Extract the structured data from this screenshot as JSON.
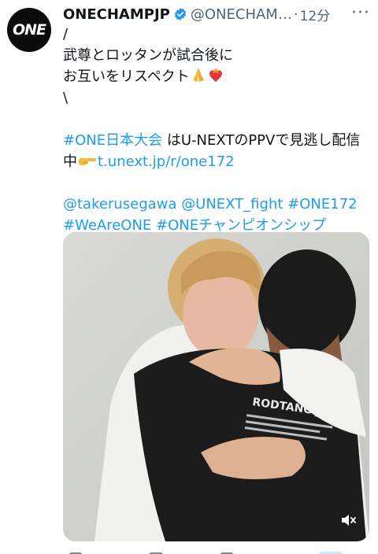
{
  "account": {
    "name": "ONECHAMPJP",
    "handle": "@ONECHAM…",
    "separator": "·",
    "time": "12分",
    "avatar_text": "ONE"
  },
  "tweet": {
    "line1": "/",
    "line2": "武尊とロッタンが試合後に",
    "line3": "お互いをリスペクト",
    "line4": "\\",
    "hashtag_event": "#ONE日本大会",
    "event_text": " はU-NEXTのPPVで見逃し配信",
    "line6_prefix": "中",
    "link": "t.unext.jp/r/one172",
    "mention1": "@takerusegawa",
    "mention2": "@UNEXT_fight",
    "hashtag2": "#ONE172",
    "hashtag3": "#WeAreONE",
    "hashtag4": "#ONEチャンピオンシップ"
  },
  "media": {
    "shirt_text": "RODTANG JI"
  },
  "icons": {
    "verified": "verified-badge-icon",
    "more": "more-icon",
    "mute": "speaker-muted-icon",
    "pray": "folded-hands-icon",
    "heart": "heart-on-fire-icon",
    "point": "pointing-hand-icon"
  },
  "colors": {
    "link": "#1d9bf0",
    "text": "#0f1419",
    "secondary": "#536471"
  }
}
